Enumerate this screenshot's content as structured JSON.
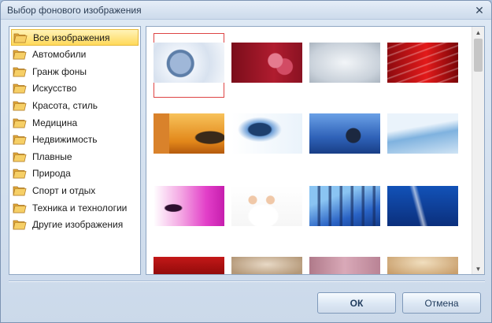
{
  "window": {
    "title": "Выбор фонового изображения"
  },
  "sidebar": {
    "items": [
      {
        "label": "Все изображения",
        "selected": true
      },
      {
        "label": "Автомобили"
      },
      {
        "label": "Гранж фоны"
      },
      {
        "label": "Искусство"
      },
      {
        "label": "Красота, стиль"
      },
      {
        "label": "Медицина"
      },
      {
        "label": "Недвижимость"
      },
      {
        "label": "Плавные"
      },
      {
        "label": "Природа"
      },
      {
        "label": "Спорт и отдых"
      },
      {
        "label": "Техника и технологии"
      },
      {
        "label": "Другие изображения"
      }
    ]
  },
  "gallery": {
    "thumbnails": [
      {
        "name": "compact-mirror",
        "selected": true
      },
      {
        "name": "red-makeup"
      },
      {
        "name": "grey-texture"
      },
      {
        "name": "red-lines"
      },
      {
        "name": "orange-film"
      },
      {
        "name": "blue-swirl"
      },
      {
        "name": "stethoscope"
      },
      {
        "name": "light-blue-gradient"
      },
      {
        "name": "pink-dancer"
      },
      {
        "name": "medical-team"
      },
      {
        "name": "blue-film-strip"
      },
      {
        "name": "blue-light-rays"
      },
      {
        "name": "red-orange"
      },
      {
        "name": "beige-grunge"
      },
      {
        "name": "purple-mauve"
      },
      {
        "name": "parchment"
      }
    ]
  },
  "buttons": {
    "ok": "ОК",
    "cancel": "Отмена"
  },
  "colors": {
    "accent": "#ffd95a",
    "selection_border": "#d44444",
    "window_bg": "#cfdcec"
  }
}
